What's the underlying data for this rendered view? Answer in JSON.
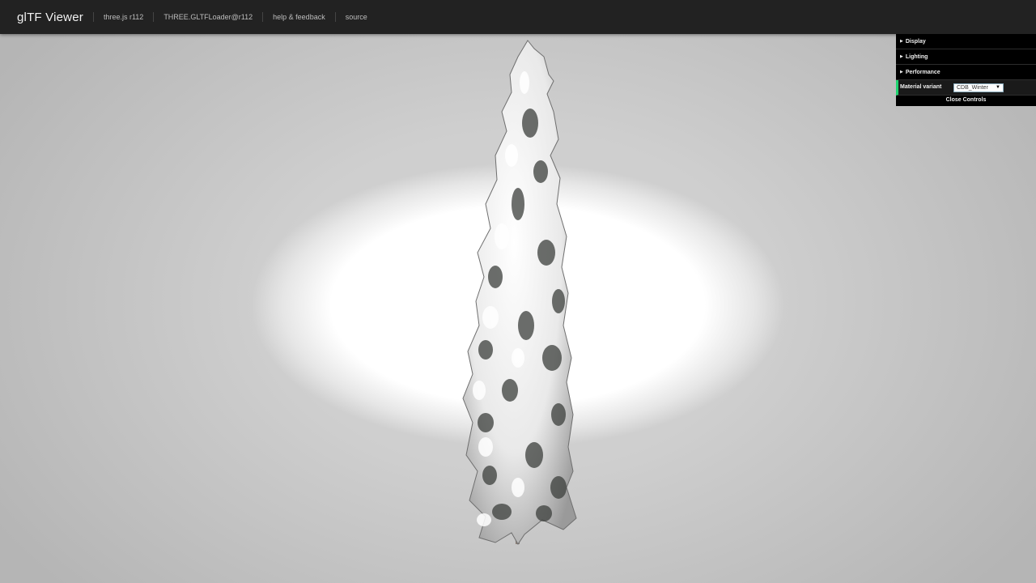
{
  "header": {
    "brand": "glTF Viewer",
    "links": [
      {
        "label": "three.js r112"
      },
      {
        "label": "THREE.GLTFLoader@r112"
      },
      {
        "label": "help & feedback"
      },
      {
        "label": "source"
      }
    ]
  },
  "gui": {
    "folders": [
      {
        "label": "Display"
      },
      {
        "label": "Lighting"
      },
      {
        "label": "Performance"
      }
    ],
    "material_variant": {
      "label": "Material variant",
      "value": "CDB_Winter"
    },
    "close_label": "Close Controls"
  },
  "colors": {
    "header_bg": "#222222",
    "gui_bg": "#000000",
    "gui_accent": "#1ed36f"
  }
}
